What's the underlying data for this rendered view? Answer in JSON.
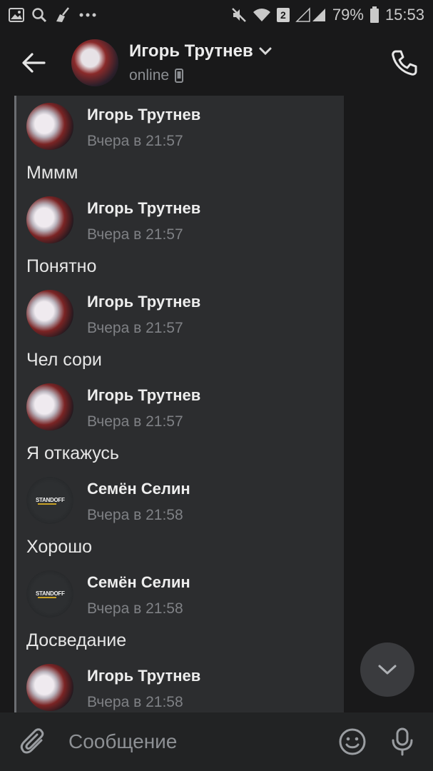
{
  "status_bar": {
    "sim_slot": "2",
    "battery": "79%",
    "time": "15:53",
    "icons": [
      "image-icon",
      "search-icon",
      "broom-icon",
      "more-icon",
      "mute-icon",
      "wifi-icon",
      "signal-icon",
      "battery-icon"
    ]
  },
  "header": {
    "title": "Игорь Трутнев",
    "status": "online",
    "icons": [
      "back-arrow-icon",
      "chevron-down-icon",
      "mobile-device-icon",
      "phone-icon"
    ]
  },
  "messages": [
    {
      "author": "Игорь Трутнев",
      "time": "Вчера в 21:57",
      "text": "Мммм"
    },
    {
      "author": "Игорь Трутнев",
      "time": "Вчера в 21:57",
      "text": "Понятно"
    },
    {
      "author": "Игорь Трутнев",
      "time": "Вчера в 21:57",
      "text": "Чел сори"
    },
    {
      "author": "Игорь Трутнев",
      "time": "Вчера в 21:57",
      "text": "Я откажусь"
    },
    {
      "author": "Семён Селин",
      "time": "Вчера в 21:58",
      "text": "Хорошо"
    },
    {
      "author": "Семён Селин",
      "time": "Вчера в 21:58",
      "text": "Досведание"
    },
    {
      "author": "Игорь Трутнев",
      "time": "Вчера в 21:58",
      "text": ""
    }
  ],
  "avatar_logo": "STANDOFF",
  "composer": {
    "placeholder": "Сообщение",
    "icons": [
      "paperclip-icon",
      "smile-icon",
      "microphone-icon"
    ]
  },
  "colors": {
    "background": "#19191a",
    "panel": "#2c2d2f",
    "accent_line": "#6c6e72",
    "muted_text": "#7f8185"
  }
}
